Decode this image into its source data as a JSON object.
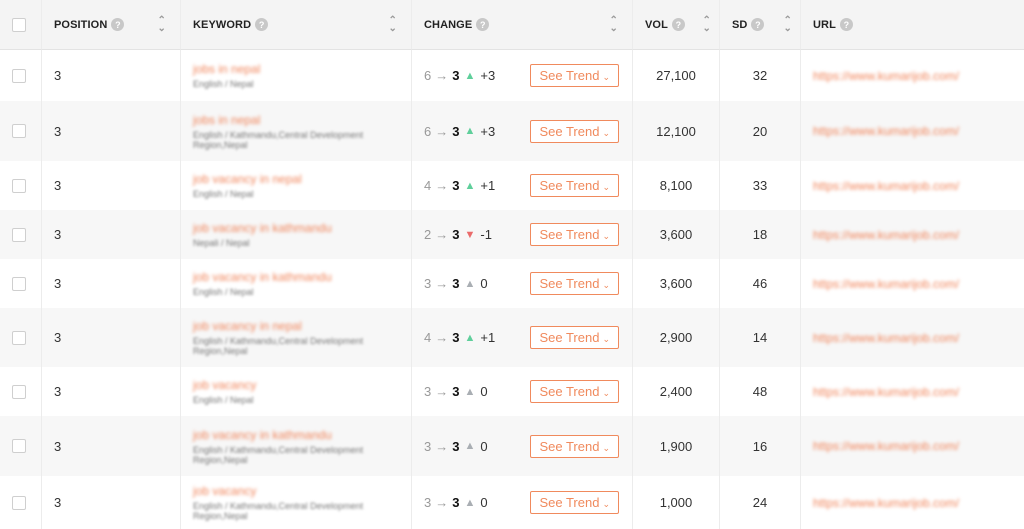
{
  "header": {
    "position": "POSITION",
    "keyword": "KEYWORD",
    "change": "CHANGE",
    "vol": "VOL",
    "sd": "SD",
    "url": "URL"
  },
  "trend_label": "See Trend",
  "colors": {
    "accent": "#f08a5d",
    "up": "#5fcf9b",
    "down": "#ea6b6b",
    "neutral": "#a9aeb3"
  },
  "rows": [
    {
      "position": "3",
      "keyword": "jobs in nepal",
      "location": "English / Nepal",
      "from": "6",
      "to": "3",
      "dir": "up",
      "delta": "+3",
      "vol": "27,100",
      "sd": "32",
      "url": "https://www.kumarijob.com/"
    },
    {
      "position": "3",
      "keyword": "jobs in nepal",
      "location": "English / Kathmandu,Central Development Region,Nepal",
      "from": "6",
      "to": "3",
      "dir": "up",
      "delta": "+3",
      "vol": "12,100",
      "sd": "20",
      "url": "https://www.kumarijob.com/"
    },
    {
      "position": "3",
      "keyword": "job vacancy in nepal",
      "location": "English / Nepal",
      "from": "4",
      "to": "3",
      "dir": "up",
      "delta": "+1",
      "vol": "8,100",
      "sd": "33",
      "url": "https://www.kumarijob.com/"
    },
    {
      "position": "3",
      "keyword": "job vacancy in kathmandu",
      "location": "Nepali / Nepal",
      "from": "2",
      "to": "3",
      "dir": "down",
      "delta": "-1",
      "vol": "3,600",
      "sd": "18",
      "url": "https://www.kumarijob.com/"
    },
    {
      "position": "3",
      "keyword": "job vacancy in kathmandu",
      "location": "English / Nepal",
      "from": "3",
      "to": "3",
      "dir": "neutral",
      "delta": "0",
      "vol": "3,600",
      "sd": "46",
      "url": "https://www.kumarijob.com/"
    },
    {
      "position": "3",
      "keyword": "job vacancy in nepal",
      "location": "English / Kathmandu,Central Development Region,Nepal",
      "from": "4",
      "to": "3",
      "dir": "up",
      "delta": "+1",
      "vol": "2,900",
      "sd": "14",
      "url": "https://www.kumarijob.com/"
    },
    {
      "position": "3",
      "keyword": "job vacancy",
      "location": "English / Nepal",
      "from": "3",
      "to": "3",
      "dir": "neutral",
      "delta": "0",
      "vol": "2,400",
      "sd": "48",
      "url": "https://www.kumarijob.com/"
    },
    {
      "position": "3",
      "keyword": "job vacancy in kathmandu",
      "location": "English / Kathmandu,Central Development Region,Nepal",
      "from": "3",
      "to": "3",
      "dir": "neutral",
      "delta": "0",
      "vol": "1,900",
      "sd": "16",
      "url": "https://www.kumarijob.com/"
    },
    {
      "position": "3",
      "keyword": "job vacancy",
      "location": "English / Kathmandu,Central Development Region,Nepal",
      "from": "3",
      "to": "3",
      "dir": "neutral",
      "delta": "0",
      "vol": "1,000",
      "sd": "24",
      "url": "https://www.kumarijob.com/"
    }
  ]
}
